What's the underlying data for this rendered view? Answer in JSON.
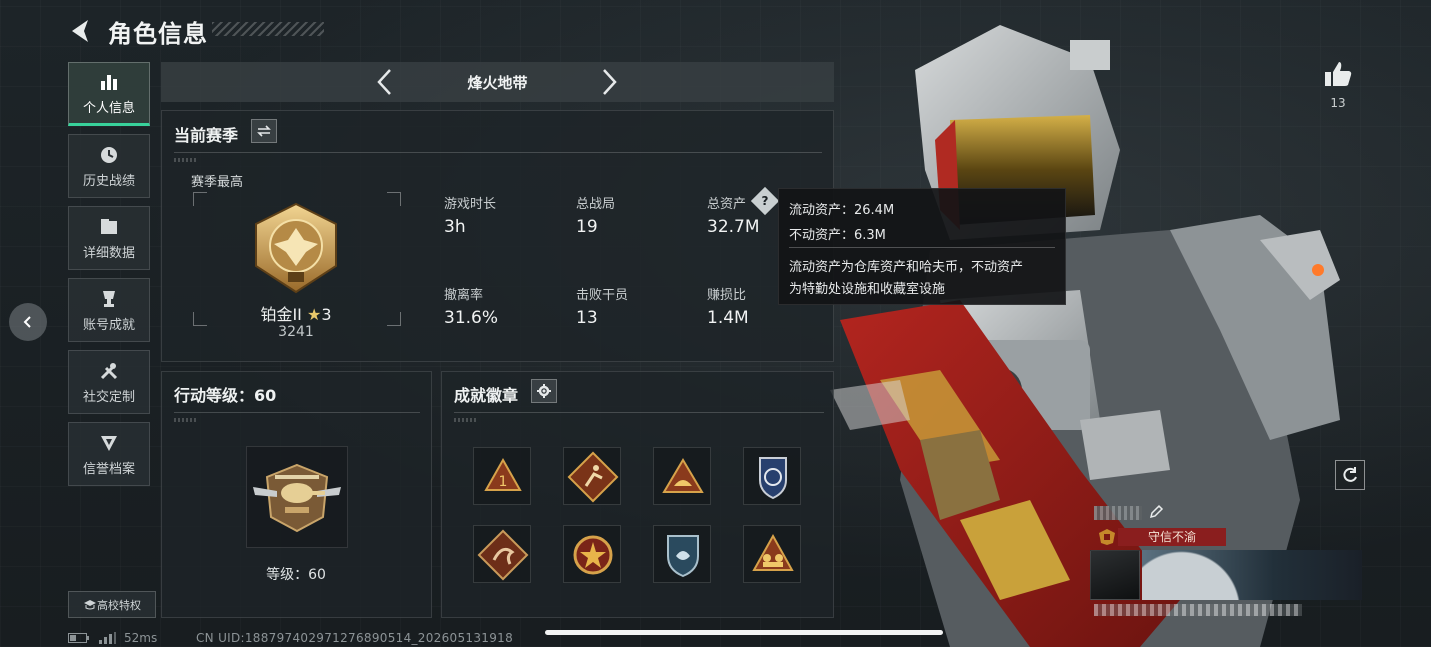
{
  "header": {
    "title": "角色信息"
  },
  "sidebar": {
    "items": [
      {
        "label": "个人信息",
        "icon": "bar-chart-icon",
        "active": true
      },
      {
        "label": "历史战绩",
        "icon": "clock-icon",
        "active": false
      },
      {
        "label": "详细数据",
        "icon": "folder-icon",
        "active": false
      },
      {
        "label": "账号成就",
        "icon": "trophy-icon",
        "active": false
      },
      {
        "label": "社交定制",
        "icon": "tools-icon",
        "active": false
      },
      {
        "label": "信誉档案",
        "icon": "shield-icon",
        "active": false
      }
    ],
    "campus_label": "高校特权"
  },
  "mode": {
    "title": "烽火地带"
  },
  "season": {
    "title": "当前赛季",
    "best_label": "赛季最高",
    "rank_name": "铂金II",
    "rank_star": "★",
    "rank_stars": "3",
    "rank_score": "3241",
    "stats": [
      {
        "label": "游戏时长",
        "value": "3h"
      },
      {
        "label": "总战局",
        "value": "19"
      },
      {
        "label": "总资产",
        "value": "32.7M"
      },
      {
        "label": "撤离率",
        "value": "31.6%"
      },
      {
        "label": "击败干员",
        "value": "13"
      },
      {
        "label": "赚损比",
        "value": "1.4M"
      }
    ]
  },
  "tooltip": {
    "liquid": "流动资产：26.4M",
    "fixed": "不动资产：6.3M",
    "desc_line1": "流动资产为仓库资产和哈夫币，不动资产",
    "desc_line2": "为特勤处设施和收藏室设施"
  },
  "action_level": {
    "title": "行动等级：60",
    "level_text": "等级：60"
  },
  "achievements": {
    "title": "成就徽章",
    "medals": [
      "medal-rank-1-icon",
      "medal-runner-icon",
      "medal-sunrise-icon",
      "medal-police-icon",
      "medal-dragon-icon",
      "medal-star-icon",
      "medal-shield-icon",
      "medal-squad-icon"
    ]
  },
  "profile": {
    "likes": "13",
    "tag": "守信不渝"
  },
  "status": {
    "ping": "52ms",
    "uid": "CN UID:1887974029712768905​14_202605131918"
  },
  "colors": {
    "accent": "#38d29b",
    "gold": "#e8c86b",
    "tag_red": "#8a1e1e"
  }
}
